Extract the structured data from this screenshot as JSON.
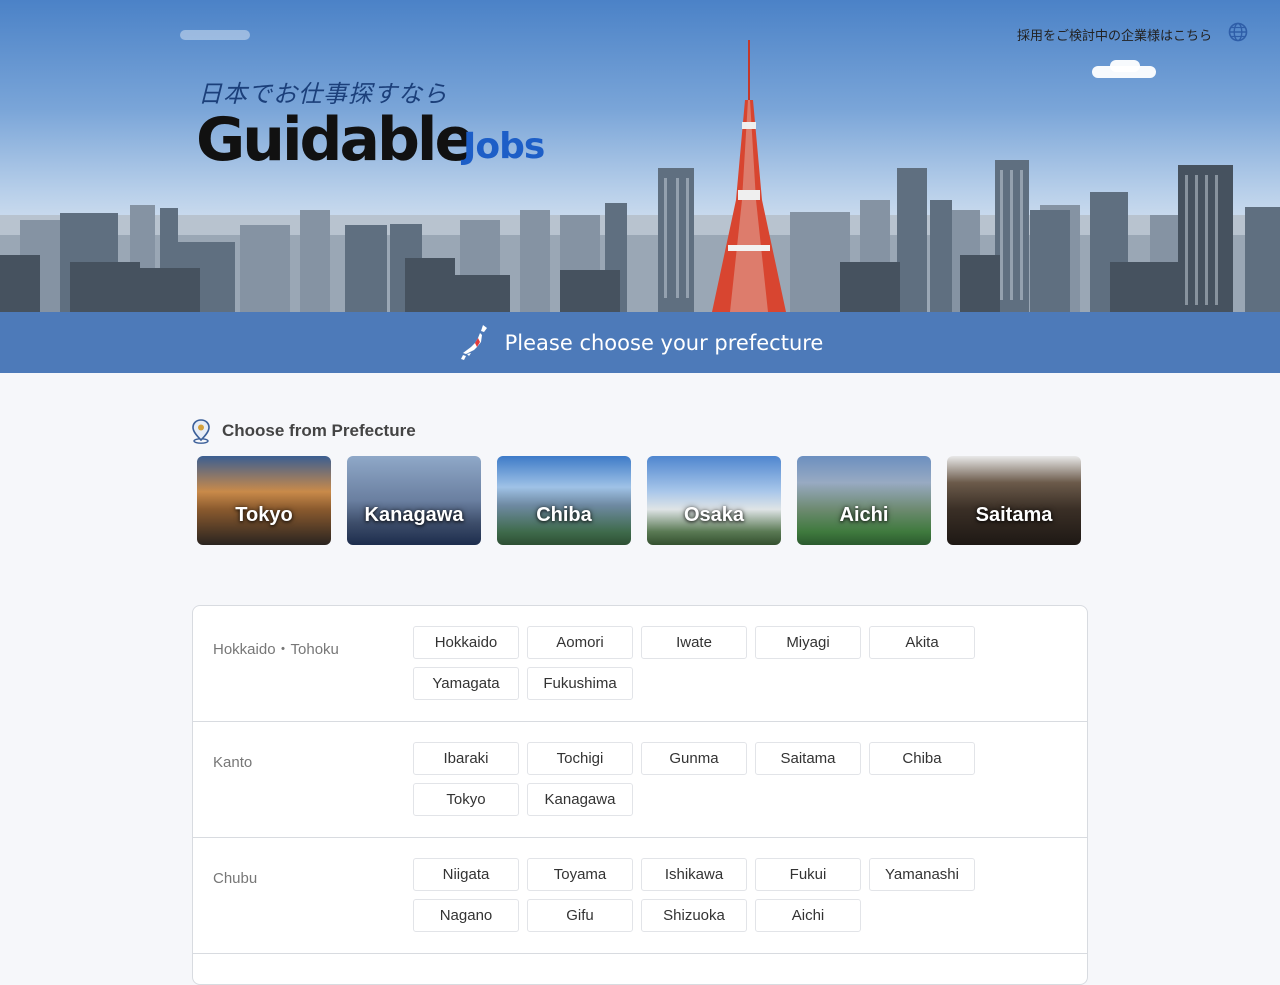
{
  "header": {
    "employer_link": "採用をご検討中の企業様はこちら",
    "logo_tagline": "日本でお仕事探すなら",
    "logo_brand": "Guidable",
    "logo_jobs": "Jobs"
  },
  "banner": {
    "title": "Please choose your prefecture"
  },
  "featured": {
    "title": "Choose from Prefecture",
    "cards": [
      {
        "label": "Tokyo"
      },
      {
        "label": "Kanagawa"
      },
      {
        "label": "Chiba"
      },
      {
        "label": "Osaka"
      },
      {
        "label": "Aichi"
      },
      {
        "label": "Saitama"
      }
    ]
  },
  "regions": [
    {
      "name": "Hokkaido・Tohoku",
      "prefectures": [
        "Hokkaido",
        "Aomori",
        "Iwate",
        "Miyagi",
        "Akita",
        "Yamagata",
        "Fukushima"
      ]
    },
    {
      "name": "Kanto",
      "prefectures": [
        "Ibaraki",
        "Tochigi",
        "Gunma",
        "Saitama",
        "Chiba",
        "Tokyo",
        "Kanagawa"
      ]
    },
    {
      "name": "Chubu",
      "prefectures": [
        "Niigata",
        "Toyama",
        "Ishikawa",
        "Fukui",
        "Yamanashi",
        "Nagano",
        "Gifu",
        "Shizuoka",
        "Aichi"
      ]
    }
  ],
  "colors": {
    "banner": "#4d7ab9",
    "brand_blue": "#1d5ec7"
  }
}
